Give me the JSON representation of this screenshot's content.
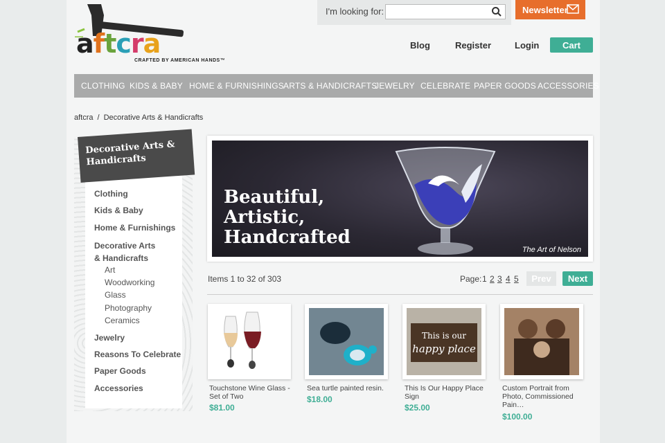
{
  "header": {
    "logo_text": "aftcra",
    "logo_letters": [
      {
        "ch": "a",
        "color": "#222222"
      },
      {
        "ch": "f",
        "color": "#e0721c"
      },
      {
        "ch": "t",
        "color": "#6aa33c"
      },
      {
        "ch": "c",
        "color": "#2a9fb6"
      },
      {
        "ch": "r",
        "color": "#d43c6a"
      },
      {
        "ch": "a",
        "color": "#e8a21c"
      }
    ],
    "tagline": "CRAFTED BY AMERICAN HANDS™",
    "search_label": "I'm looking for:",
    "search_value": "",
    "search_icon": "search-icon",
    "newsletter_label": "Newsletter",
    "links": [
      "Blog",
      "Register",
      "Login"
    ],
    "cart_label": "Cart"
  },
  "nav": {
    "items": [
      "CLOTHING",
      "KIDS & BABY",
      "HOME & FURNISHINGS",
      "ARTS & HANDICRAFTS",
      "JEWELRY",
      "CELEBRATE",
      "PAPER GOODS",
      "ACCESSORIES"
    ]
  },
  "breadcrumb": {
    "root": "aftcra",
    "separator": "/",
    "current": "Decorative Arts & Handicrafts"
  },
  "sidebar": {
    "title": "Decorative Arts & Handicrafts",
    "items": [
      {
        "label": "Clothing"
      },
      {
        "label": "Kids & Baby"
      },
      {
        "label": "Home & Furnishings"
      },
      {
        "label": "Decorative Arts & Handicrafts"
      },
      {
        "label": "Jewelry"
      },
      {
        "label": "Reasons To Celebrate"
      },
      {
        "label": "Paper Goods"
      },
      {
        "label": "Accessories"
      }
    ],
    "subitems": [
      "Art",
      "Woodworking",
      "Glass",
      "Photography",
      "Ceramics"
    ]
  },
  "banner": {
    "headline_lines": [
      "Beautiful,",
      "Artistic,",
      "Handcrafted"
    ],
    "credit": "The Art of Nelson"
  },
  "pagination": {
    "items_text": "Items 1 to 32 of 303",
    "page_label": "Page:",
    "pages": [
      "1",
      "2",
      "3",
      "4",
      "5"
    ],
    "prev_label": "Prev",
    "next_label": "Next"
  },
  "products": [
    {
      "name": "Touchstone Wine Glass - Set of Two",
      "price": "$81.00"
    },
    {
      "name": "Sea turtle painted resin.",
      "price": "$18.00"
    },
    {
      "name": "This Is Our Happy Place Sign",
      "price": "$25.00"
    },
    {
      "name": "Custom Portrait from Photo, Commissioned Pain…",
      "price": "$100.00"
    }
  ],
  "sign_text": [
    "This is our",
    "happy place"
  ],
  "colors": {
    "accent": "#3fae95",
    "newsletter": "#e76e2c",
    "nav_bg": "#a9aaaa",
    "sidebar_title_bg": "#4a4a4a"
  }
}
